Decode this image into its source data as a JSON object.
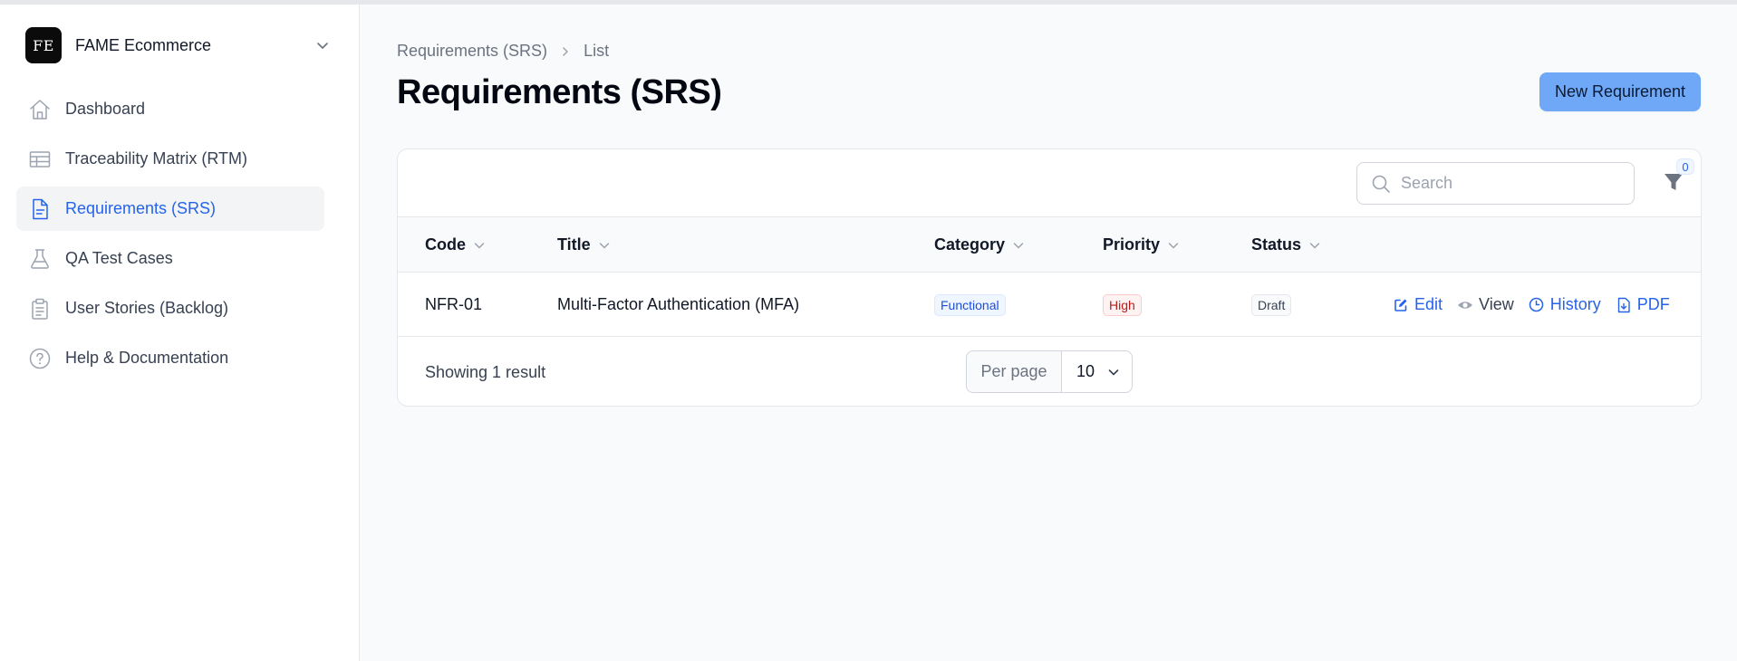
{
  "sidebar": {
    "tenant": {
      "initials": "FE",
      "name": "FAME Ecommerce",
      "chevron_icon": "chevron-down-icon"
    },
    "items": [
      {
        "label": "Dashboard",
        "icon": "home-icon",
        "active": false
      },
      {
        "label": "Traceability Matrix (RTM)",
        "icon": "table-icon",
        "active": false
      },
      {
        "label": "Requirements (SRS)",
        "icon": "document-icon",
        "active": true
      },
      {
        "label": "QA Test Cases",
        "icon": "beaker-icon",
        "active": false
      },
      {
        "label": "User Stories (Backlog)",
        "icon": "clipboard-icon",
        "active": false
      },
      {
        "label": "Help & Documentation",
        "icon": "question-icon",
        "active": false
      }
    ]
  },
  "header": {
    "breadcrumb": [
      "Requirements (SRS)",
      "List"
    ],
    "title": "Requirements (SRS)",
    "new_button": "New Requirement"
  },
  "table": {
    "search_placeholder": "Search",
    "filter_count": "0",
    "columns": [
      "Code",
      "Title",
      "Category",
      "Priority",
      "Status"
    ],
    "rows": [
      {
        "code": "NFR-01",
        "title": "Multi-Factor Authentication (MFA)",
        "category": "Functional",
        "priority": "High",
        "status": "Draft",
        "actions": [
          "Edit",
          "View",
          "History",
          "PDF"
        ]
      }
    ],
    "result_text": "Showing 1 result",
    "per_page_label": "Per page",
    "per_page_value": "10"
  },
  "colors": {
    "accent": "#2563eb",
    "button_bg": "#6ea8f7",
    "priority_high": "#b91c1c"
  }
}
